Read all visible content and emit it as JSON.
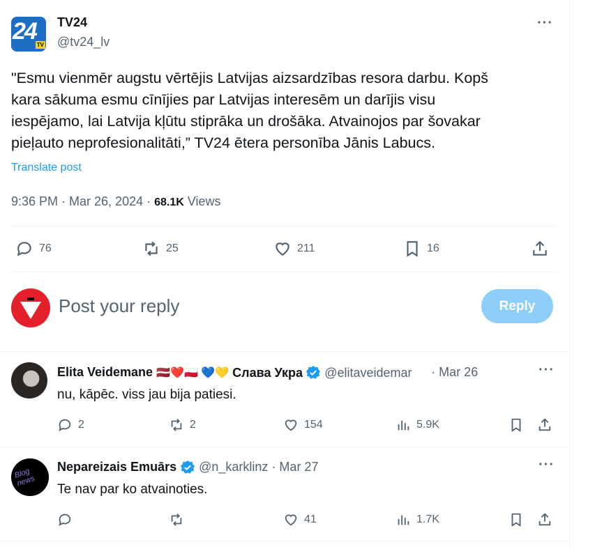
{
  "post": {
    "author_name": "TV24",
    "author_handle": "@tv24_lv",
    "avatar_text": "24",
    "avatar_badge": "TV",
    "text_lines": [
      "\"Esmu vienmēr augstu vērtējis Latvijas aizsardzības resora darbu. Kopš",
      "kara sākuma esmu cīnījies par Latvijas interesēm un darījis visu",
      "iespējamo, lai Latvija kļūtu stiprāka un drošāka. Atvainojos par šovakar",
      "pieļauto neprofesionalitāti,” TV24 ētera personība Jānis Labucs."
    ],
    "translate": "Translate post",
    "time": "9:36 PM · Mar 26, 2024 · ",
    "views_count": "68.1K",
    "views_label": " Views",
    "more": "···",
    "stats": {
      "replies": "76",
      "reposts": "25",
      "likes": "211",
      "bookmarks": "16"
    }
  },
  "composer": {
    "placeholder": "Post your reply",
    "reply_button": "Reply"
  },
  "replies": [
    {
      "name": "Elita Veidemane",
      "flags": "🇱🇻❤️🇵🇱 💙💛",
      "name_suffix": "Слава Укра",
      "handle": "@elitaveidemar",
      "date": " · Mar 26",
      "text": "nu, kāpēc. viss jau bija patiesi.",
      "replies": "2",
      "reposts": "2",
      "likes": "154",
      "views": "5.9K",
      "more": "···"
    },
    {
      "name": "Nepareizais Emuārs",
      "handle": "@n_karklinz",
      "date": " · Mar 27",
      "text": "Te nav par ko atvainoties.",
      "avatar_text": "Blog news",
      "replies": "",
      "reposts": "",
      "likes": "41",
      "views": "1.7K",
      "more": "···"
    }
  ],
  "colors": {
    "accent": "#1d9bf0",
    "reply_btn": "#8ecdf8",
    "like": "#536471"
  }
}
